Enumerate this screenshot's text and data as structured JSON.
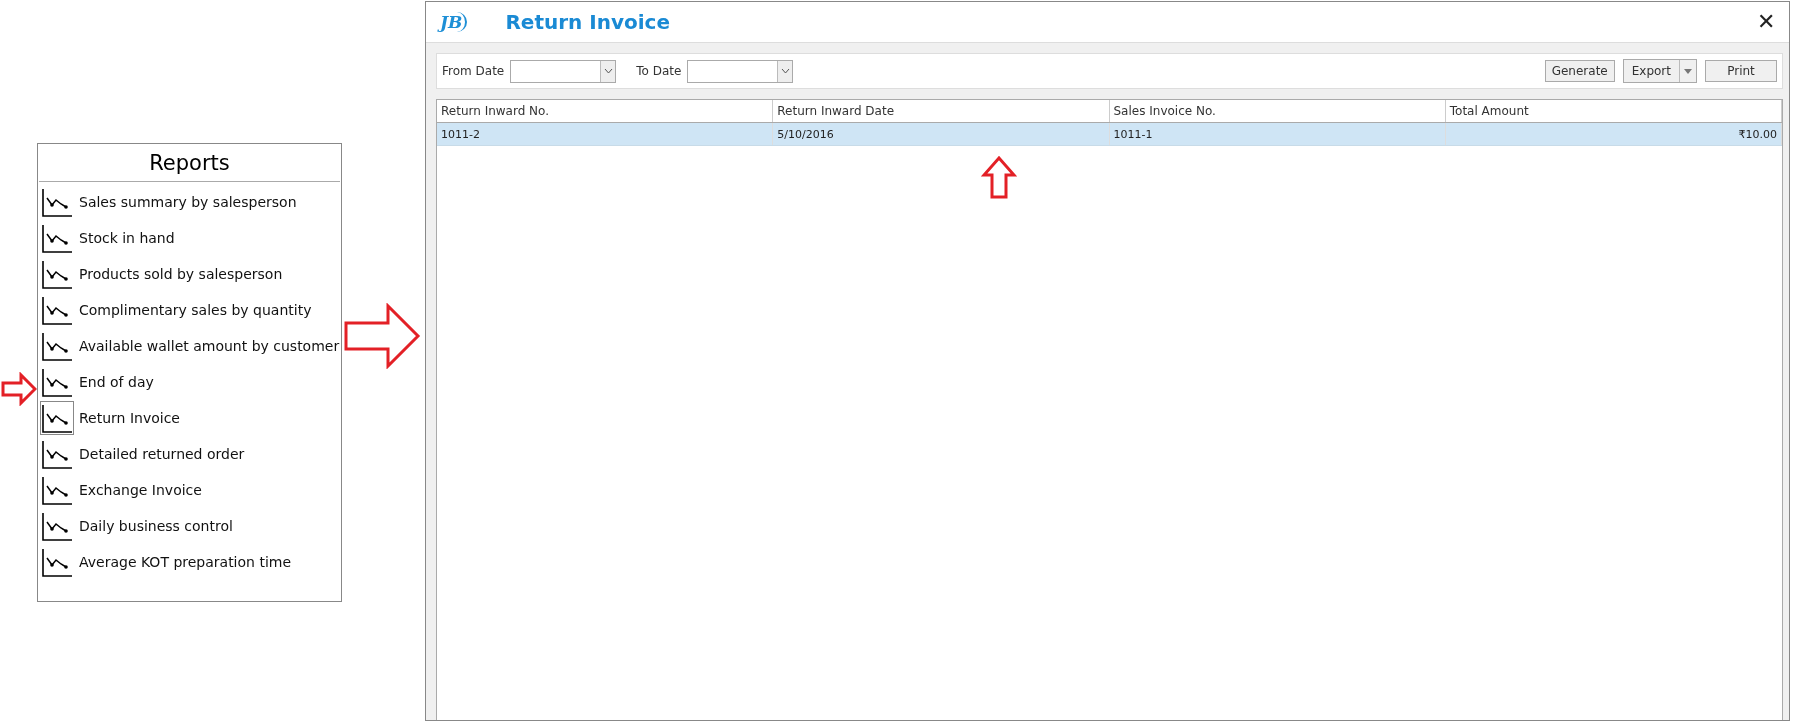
{
  "reports_panel": {
    "title": "Reports",
    "items": [
      {
        "label": "Sales summary by salesperson",
        "selected": false
      },
      {
        "label": "Stock in hand",
        "selected": false
      },
      {
        "label": "Products sold by salesperson",
        "selected": false
      },
      {
        "label": "Complimentary sales by quantity",
        "selected": false
      },
      {
        "label": "Available wallet amount by customer",
        "selected": false
      },
      {
        "label": "End of day",
        "selected": false
      },
      {
        "label": "Return Invoice",
        "selected": true
      },
      {
        "label": "Detailed returned order",
        "selected": false
      },
      {
        "label": "Exchange Invoice",
        "selected": false
      },
      {
        "label": "Daily business control",
        "selected": false
      },
      {
        "label": "Average KOT preparation time",
        "selected": false
      }
    ]
  },
  "window": {
    "logo": "JB",
    "title": "Return Invoice",
    "close": "✕"
  },
  "filters": [
    {
      "label": "From Date"
    },
    {
      "label": "To Date"
    }
  ],
  "buttons": [
    {
      "label": "Generate",
      "kind": "plain"
    },
    {
      "label": "Export",
      "kind": "split"
    },
    {
      "label": "Print",
      "kind": "plain"
    }
  ],
  "table": {
    "columns": [
      {
        "label": "Return Inward No.",
        "kind": "text"
      },
      {
        "label": "Return Inward Date",
        "kind": "text"
      },
      {
        "label": "Sales Invoice No.",
        "kind": "text"
      },
      {
        "label": "Total Amount",
        "kind": "amount"
      }
    ],
    "rows": [
      {
        "cells": [
          "1011-2",
          "5/10/2016",
          "1011-1",
          "₹10.00"
        ],
        "selected": true
      }
    ]
  }
}
